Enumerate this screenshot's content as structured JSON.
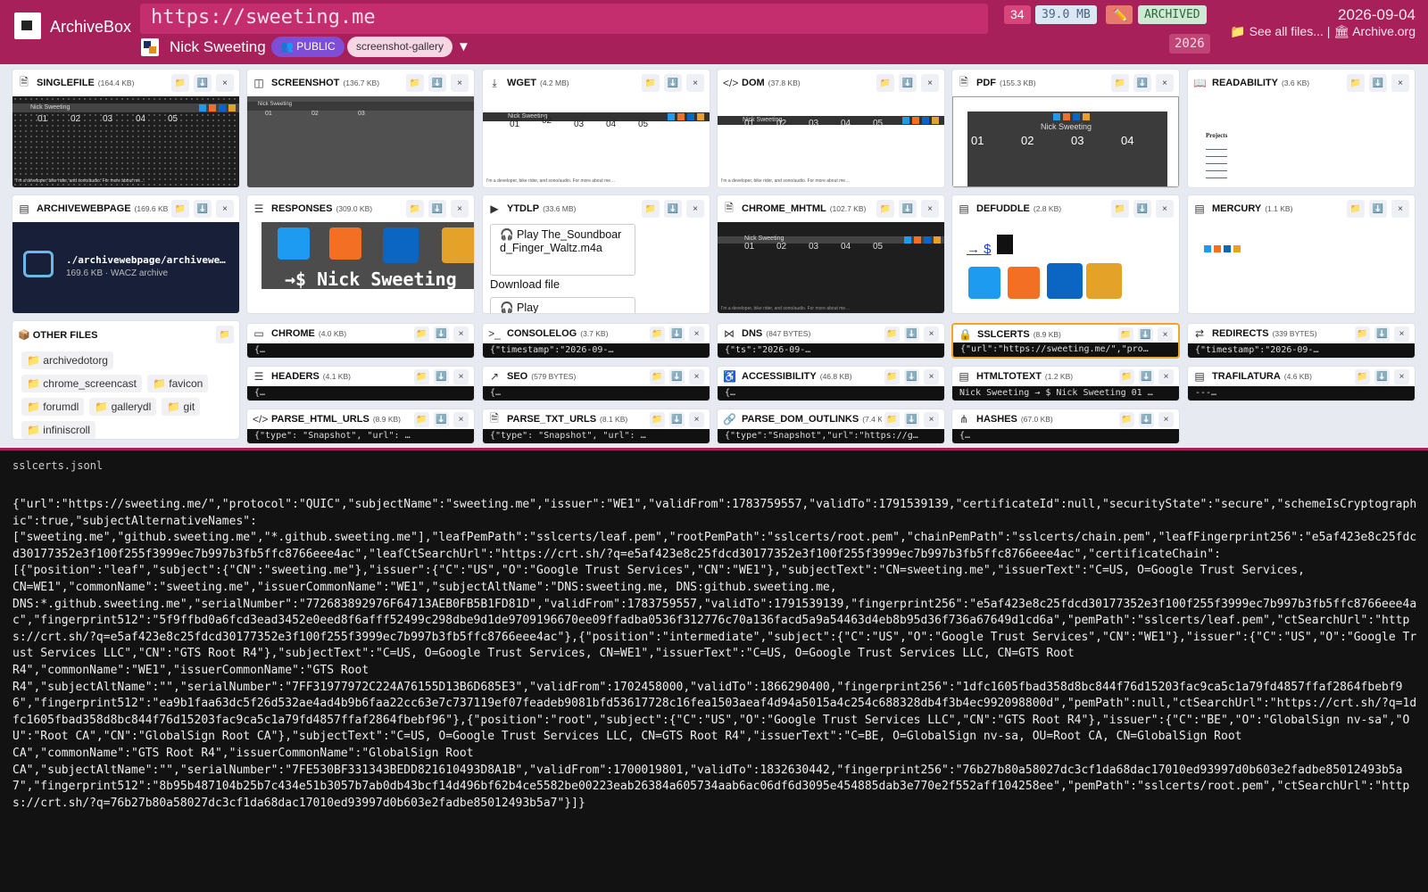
{
  "header": {
    "brand": "ArchiveBox",
    "url": "https://sweeting.me",
    "author": "Nick Sweeting",
    "visibility": "👥 PUBLIC",
    "tag": "screenshot-gallery",
    "dropdown": "▼",
    "count": "34",
    "size": "39.0 MB",
    "edit": "✏️",
    "status": "ARCHIVED",
    "year": "2026",
    "date": "2026-09-04",
    "see_all": "📁 See all files...",
    "sep": " | ",
    "archive_org": "🏛 Archive.org"
  },
  "cards": [
    {
      "icon": "🗎",
      "title": "SINGLEFILE",
      "size": "(164.4 KB)"
    },
    {
      "icon": "◫",
      "title": "SCREENSHOT",
      "size": "(136.7 KB)"
    },
    {
      "icon": "⤓",
      "title": "WGET",
      "size": "(4.2 MB)"
    },
    {
      "icon": "</>",
      "title": "DOM",
      "size": "(37.8 KB)"
    },
    {
      "icon": "🗎",
      "title": "PDF",
      "size": "(155.3 KB)"
    },
    {
      "icon": "📖",
      "title": "READABILITY",
      "size": "(3.6 KB)"
    },
    {
      "icon": "▤",
      "title": "ARCHIVEWEBPAGE",
      "size": "(169.6 KB)"
    },
    {
      "icon": "☰",
      "title": "RESPONSES",
      "size": "(309.0 KB)"
    },
    {
      "icon": "▶",
      "title": "YTDLP",
      "size": "(33.6 MB)"
    },
    {
      "icon": "🗎",
      "title": "CHROME_MHTML",
      "size": "(102.7 KB)"
    },
    {
      "icon": "▤",
      "title": "DEFUDDLE",
      "size": "(2.8 KB)"
    },
    {
      "icon": "▤",
      "title": "MERCURY",
      "size": "(1.1 KB)"
    }
  ],
  "other_files": {
    "title": "📦 OTHER FILES",
    "items": [
      "📁 archivedotorg",
      "📁 chrome_screencast",
      "📁 favicon",
      "📁 forumdl",
      "📁 gallerydl",
      "📁 git",
      "📁 infiniscroll"
    ]
  },
  "mini": [
    {
      "icon": "▭",
      "title": "CHROME",
      "size": "(4.0 KB)",
      "code": "{…"
    },
    {
      "icon": ">_",
      "title": "CONSOLELOG",
      "size": "(3.7 KB)",
      "code": "{\"timestamp\":\"2026-09-…"
    },
    {
      "icon": "⋈",
      "title": "DNS",
      "size": "(847 BYTES)",
      "code": "{\"ts\":\"2026-09-…"
    },
    {
      "icon": "🔒",
      "title": "SSLCERTS",
      "size": "(8.9 KB)",
      "code": "{\"url\":\"https://sweeting.me/\",\"pro…"
    },
    {
      "icon": "⇄",
      "title": "REDIRECTS",
      "size": "(339 BYTES)",
      "code": "{\"timestamp\":\"2026-09-…"
    },
    {
      "icon": "☰",
      "title": "HEADERS",
      "size": "(4.1 KB)",
      "code": "{…"
    },
    {
      "icon": "↗",
      "title": "SEO",
      "size": "(579 BYTES)",
      "code": "{…"
    },
    {
      "icon": "♿",
      "title": "ACCESSIBILITY",
      "size": "(46.8 KB)",
      "code": "{…"
    },
    {
      "icon": "▤",
      "title": "HTMLTOTEXT",
      "size": "(1.2 KB)",
      "code": "Nick Sweeting → $ Nick Sweeting 01 …"
    },
    {
      "icon": "▤",
      "title": "TRAFILATURA",
      "size": "(4.6 KB)",
      "code": "---…"
    },
    {
      "icon": "</>",
      "title": "PARSE_HTML_URLS",
      "size": "(8.9 KB)",
      "code": "{\"type\": \"Snapshot\", \"url\": …"
    },
    {
      "icon": "🗎",
      "title": "PARSE_TXT_URLS",
      "size": "(8.1 KB)",
      "code": "{\"type\": \"Snapshot\", \"url\": …"
    },
    {
      "icon": "🔗",
      "title": "PARSE_DOM_OUTLINKS",
      "size": "(7.4 KB)",
      "code": "{\"type\":\"Snapshot\",\"url\":\"https://g…"
    },
    {
      "icon": "⋔",
      "title": "HASHES",
      "size": "(67.0 KB)",
      "code": "{…"
    }
  ],
  "previews": {
    "site_name": "Nick Sweeting",
    "nums": [
      "01",
      "02",
      "03",
      "04",
      "05"
    ],
    "tagline": "I'm a developer, bike rider, and sono/audio. For more about me…",
    "prompt": "→$ Nick Sweeting",
    "archwp_path": "./archivewebpage/archivewe…",
    "archwp_meta": "169.6 KB · WACZ archive",
    "ytdlp_play": "🎧 Play The_Soundboard_Finger_Waltz.m4a",
    "ytdlp_download": "Download file",
    "ytdlp_play2": "🎧 Play",
    "readability_title": "Projects",
    "defuddle_prompt": "→ $"
  },
  "buttons": {
    "folder": "📁",
    "download": "⬇️",
    "close": "×"
  },
  "panel": {
    "filename": "sslcerts.jsonl",
    "content": "{\"url\":\"https://sweeting.me/\",\"protocol\":\"QUIC\",\"subjectName\":\"sweeting.me\",\"issuer\":\"WE1\",\"validFrom\":1783759557,\"validTo\":1791539139,\"certificateId\":null,\"securityState\":\"secure\",\"schemeIsCryptographic\":true,\"subjectAlternativeNames\":\n[\"sweeting.me\",\"github.sweeting.me\",\"*.github.sweeting.me\"],\"leafPemPath\":\"sslcerts/leaf.pem\",\"rootPemPath\":\"sslcerts/root.pem\",\"chainPemPath\":\"sslcerts/chain.pem\",\"leafFingerprint256\":\"e5af423e8c25fdcd30177352e3f100f255f3999ec7b997b3fb5ffc8766eee4ac\",\"leafCtSearchUrl\":\"https://crt.sh/?q=e5af423e8c25fdcd30177352e3f100f255f3999ec7b997b3fb5ffc8766eee4ac\",\"certificateChain\":\n[{\"position\":\"leaf\",\"subject\":{\"CN\":\"sweeting.me\"},\"issuer\":{\"C\":\"US\",\"O\":\"Google Trust Services\",\"CN\":\"WE1\"},\"subjectText\":\"CN=sweeting.me\",\"issuerText\":\"C=US, O=Google Trust Services,\nCN=WE1\",\"commonName\":\"sweeting.me\",\"issuerCommonName\":\"WE1\",\"subjectAltName\":\"DNS:sweeting.me, DNS:github.sweeting.me,\nDNS:*.github.sweeting.me\",\"serialNumber\":\"772683892976F64713AEB0FB5B1FD81D\",\"validFrom\":1783759557,\"validTo\":1791539139,\"fingerprint256\":\"e5af423e8c25fdcd30177352e3f100f255f3999ec7b997b3fb5ffc8766eee4ac\",\"fingerprint512\":\"5f9ffbd0a6fcd3ead3452e0eed8f6afff52499c298dbe9d1de9709196670ee09ffadba0536f312776c70a136facd5a9a54463d4eb8b95d36f736a67649d1cd6a\",\"pemPath\":\"sslcerts/leaf.pem\",\"ctSearchUrl\":\"https://crt.sh/?q=e5af423e8c25fdcd30177352e3f100f255f3999ec7b997b3fb5ffc8766eee4ac\"},{\"position\":\"intermediate\",\"subject\":{\"C\":\"US\",\"O\":\"Google Trust Services\",\"CN\":\"WE1\"},\"issuer\":{\"C\":\"US\",\"O\":\"Google Trust Services LLC\",\"CN\":\"GTS Root R4\"},\"subjectText\":\"C=US, O=Google Trust Services, CN=WE1\",\"issuerText\":\"C=US, O=Google Trust Services LLC, CN=GTS Root\nR4\",\"commonName\":\"WE1\",\"issuerCommonName\":\"GTS Root\nR4\",\"subjectAltName\":\"\",\"serialNumber\":\"7FF31977972C224A76155D13B6D685E3\",\"validFrom\":1702458000,\"validTo\":1866290400,\"fingerprint256\":\"1dfc1605fbad358d8bc844f76d15203fac9ca5c1a79fd4857ffaf2864fbebf96\",\"fingerprint512\":\"ea9b1faa63dc5f26d532ae4ad4b9b6faa22cc63e7c737119ef07feadeb9081bfd53617728c16fea1503aeaf4d94a5015a4c254c688328db4f3b4ec992098800d\",\"pemPath\":null,\"ctSearchUrl\":\"https://crt.sh/?q=1dfc1605fbad358d8bc844f76d15203fac9ca5c1a79fd4857ffaf2864fbebf96\"},{\"position\":\"root\",\"subject\":{\"C\":\"US\",\"O\":\"Google Trust Services LLC\",\"CN\":\"GTS Root R4\"},\"issuer\":{\"C\":\"BE\",\"O\":\"GlobalSign nv-sa\",\"OU\":\"Root CA\",\"CN\":\"GlobalSign Root CA\"},\"subjectText\":\"C=US, O=Google Trust Services LLC, CN=GTS Root R4\",\"issuerText\":\"C=BE, O=GlobalSign nv-sa, OU=Root CA, CN=GlobalSign Root\nCA\",\"commonName\":\"GTS Root R4\",\"issuerCommonName\":\"GlobalSign Root\nCA\",\"subjectAltName\":\"\",\"serialNumber\":\"7FE530BF331343BEDD821610493D8A1B\",\"validFrom\":1700019801,\"validTo\":1832630442,\"fingerprint256\":\"76b27b80a58027dc3cf1da68dac17010ed93997d0b603e2fadbe85012493b5a7\",\"fingerprint512\":\"8b95b487104b25b7c434e51b3057b7ab0db43bcf14d496bf62b4ce5582be00223eab26384a605734aab6ac06df6d3095e454885dab3e770e2f552aff104258ee\",\"pemPath\":\"sslcerts/root.pem\",\"ctSearchUrl\":\"https://crt.sh/?q=76b27b80a58027dc3cf1da68dac17010ed93997d0b603e2fadbe85012493b5a7\"}]}"
  }
}
